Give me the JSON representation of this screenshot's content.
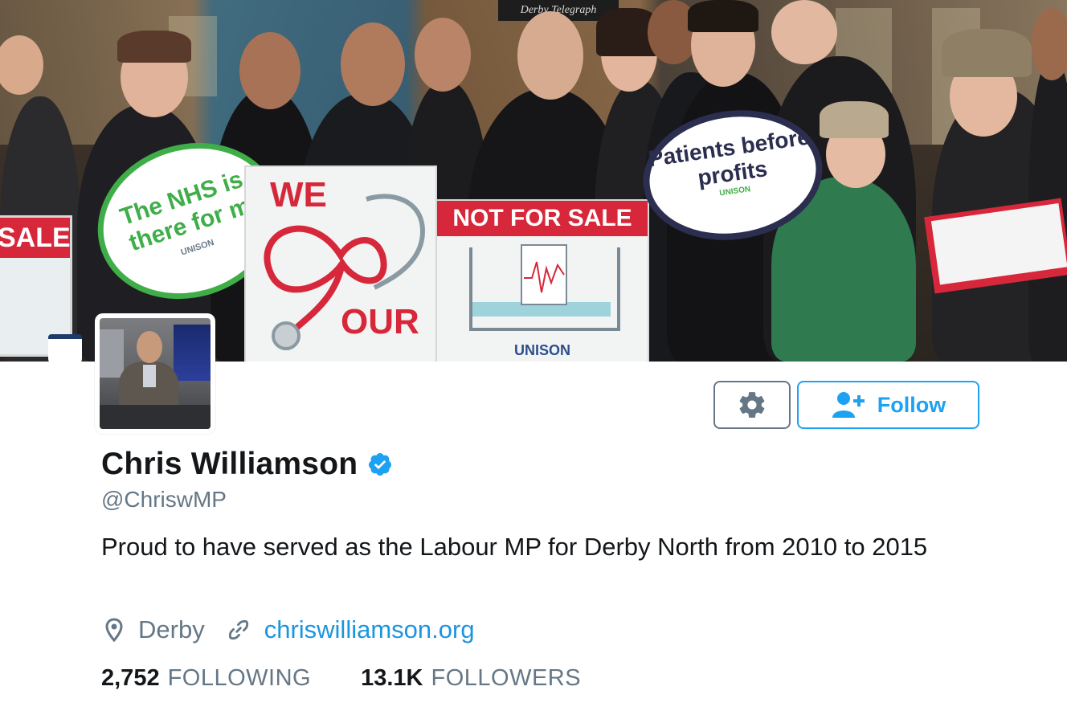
{
  "header": {
    "sign_sale": "SALE",
    "sign_nhs": "The NHS is there for m",
    "sign_we": "WE",
    "sign_our": "OUR",
    "sign_not_for_sale": "NOT FOR SALE",
    "sign_unison": "UNISON",
    "sign_patients_before_profits": "Patients before profits",
    "newspaper": "Derby Telegraph"
  },
  "profile": {
    "display_name": "Chris Williamson",
    "handle": "@ChriswMP",
    "bio": "Proud to have served as the Labour MP for Derby North from 2010 to 2015",
    "location": "Derby",
    "website": "chriswilliamson.org",
    "verified": true
  },
  "actions": {
    "follow_label": "Follow",
    "settings_icon": "gear-icon",
    "follow_icon": "add-user-icon"
  },
  "stats": {
    "following_count": "2,752",
    "following_label": "FOLLOWING",
    "followers_count": "13.1K",
    "followers_label": "FOLLOWERS"
  },
  "colors": {
    "accent": "#1da1f2",
    "link": "#1b95e0",
    "muted": "#657786",
    "text": "#14171a"
  }
}
